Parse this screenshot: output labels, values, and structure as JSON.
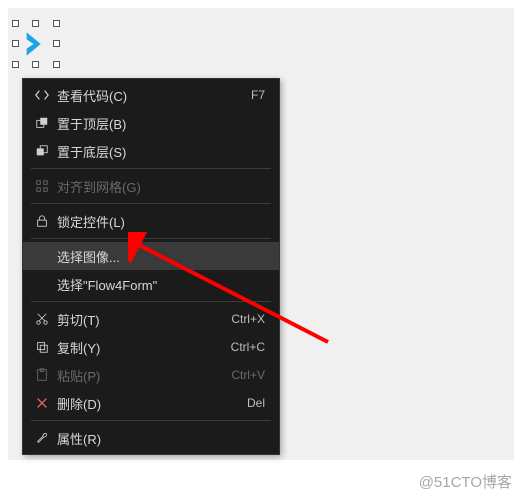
{
  "watermark": "@51CTO博客",
  "selected_control": {
    "name": "chevron-shape",
    "color": "#1aa4e8"
  },
  "menu": {
    "items": [
      {
        "id": "view-code",
        "icon": "code-icon",
        "label": "查看代码(C)",
        "shortcut": "F7",
        "enabled": true
      },
      {
        "id": "bring-front",
        "icon": "bring-front-icon",
        "label": "置于顶层(B)",
        "shortcut": "",
        "enabled": true
      },
      {
        "id": "send-back",
        "icon": "send-back-icon",
        "label": "置于底层(S)",
        "shortcut": "",
        "enabled": true
      },
      {
        "id": "sep1",
        "type": "separator"
      },
      {
        "id": "align-grid",
        "icon": "align-grid-icon",
        "label": "对齐到网格(G)",
        "shortcut": "",
        "enabled": false
      },
      {
        "id": "sep2",
        "type": "separator"
      },
      {
        "id": "lock",
        "icon": "lock-icon",
        "label": "锁定控件(L)",
        "shortcut": "",
        "enabled": true
      },
      {
        "id": "sep3",
        "type": "separator"
      },
      {
        "id": "select-image",
        "icon": "",
        "label": "选择图像...",
        "shortcut": "",
        "enabled": true,
        "hovered": true
      },
      {
        "id": "select-flow",
        "icon": "",
        "label": "选择\"Flow4Form\"",
        "shortcut": "",
        "enabled": true
      },
      {
        "id": "sep4",
        "type": "separator"
      },
      {
        "id": "cut",
        "icon": "cut-icon",
        "label": "剪切(T)",
        "shortcut": "Ctrl+X",
        "enabled": true
      },
      {
        "id": "copy",
        "icon": "copy-icon",
        "label": "复制(Y)",
        "shortcut": "Ctrl+C",
        "enabled": true
      },
      {
        "id": "paste",
        "icon": "paste-icon",
        "label": "粘贴(P)",
        "shortcut": "Ctrl+V",
        "enabled": false
      },
      {
        "id": "delete",
        "icon": "delete-icon",
        "label": "删除(D)",
        "shortcut": "Del",
        "enabled": true
      },
      {
        "id": "sep5",
        "type": "separator"
      },
      {
        "id": "properties",
        "icon": "wrench-icon",
        "label": "属性(R)",
        "shortcut": "",
        "enabled": true
      }
    ]
  },
  "annotation": {
    "type": "arrow",
    "color": "#ff0000",
    "points_to": "select-image"
  }
}
